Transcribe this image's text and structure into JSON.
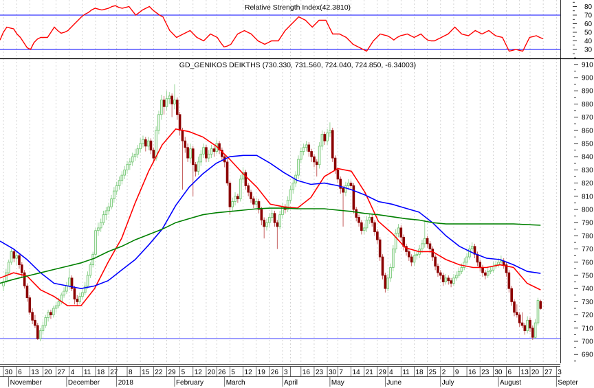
{
  "rsi_panel": {
    "title": "Relative Strength Index(42.3810)",
    "y_ticks": [
      80,
      70,
      60,
      50,
      40,
      30
    ],
    "ylim": [
      22,
      88
    ],
    "overbought": 70,
    "oversold": 30,
    "line_color": "#ff0000",
    "level_color": "#0000ff"
  },
  "price_panel": {
    "title": "GD_GENIKOS DEIKTHS (730.330, 731.560, 724.040, 724.850, -6.34003)",
    "y_ticks": [
      910,
      900,
      890,
      880,
      870,
      860,
      850,
      840,
      830,
      820,
      810,
      800,
      790,
      780,
      770,
      760,
      750,
      740,
      730,
      720,
      710,
      700,
      690
    ],
    "support_level": 702,
    "up_color": "#5cb85c",
    "down_color": "#8b0000"
  },
  "x_axis": {
    "day_labels": [
      "30",
      "6",
      "13",
      "20",
      "27",
      "4",
      "11",
      "18",
      "27",
      "",
      "8",
      "15",
      "22",
      "29",
      "5",
      "12",
      "20",
      "26",
      "5",
      "12",
      "19",
      "26",
      "3",
      "",
      "16",
      "23",
      "30",
      "7",
      "14",
      "21",
      "29",
      "4",
      "11",
      "18",
      "25",
      "2",
      "9",
      "16",
      "23",
      "30",
      "6",
      "13",
      "20",
      "27",
      "3"
    ],
    "month_labels": [
      "November",
      "December",
      "2018",
      "February",
      "March",
      "April",
      "May",
      "June",
      "July",
      "August",
      "Septer"
    ]
  },
  "chart_data": {
    "type": "candlestick",
    "title": "GD_GENIKOS DEIKTHS",
    "last_bar": {
      "open": 730.33,
      "high": 731.56,
      "low": 724.04,
      "close": 724.85,
      "change": -6.34003
    },
    "ylim": [
      685,
      915
    ],
    "grid": "vertical dotted",
    "candles_ohlc": [
      [
        742,
        748,
        738,
        745
      ],
      [
        745,
        755,
        744,
        752
      ],
      [
        752,
        762,
        750,
        760
      ],
      [
        760,
        770,
        758,
        768
      ],
      [
        768,
        770,
        760,
        763
      ],
      [
        763,
        768,
        758,
        765
      ],
      [
        765,
        767,
        755,
        758
      ],
      [
        758,
        760,
        748,
        752
      ],
      [
        752,
        754,
        740,
        742
      ],
      [
        742,
        744,
        730,
        733
      ],
      [
        733,
        735,
        720,
        722
      ],
      [
        722,
        725,
        713,
        716
      ],
      [
        716,
        720,
        710,
        712
      ],
      [
        712,
        714,
        701,
        702
      ],
      [
        702,
        710,
        700,
        708
      ],
      [
        708,
        715,
        705,
        712
      ],
      [
        712,
        720,
        710,
        718
      ],
      [
        718,
        724,
        715,
        722
      ],
      [
        722,
        724,
        717,
        720
      ],
      [
        720,
        727,
        718,
        725
      ],
      [
        725,
        730,
        722,
        727
      ],
      [
        727,
        733,
        725,
        730
      ],
      [
        730,
        737,
        728,
        735
      ],
      [
        735,
        741,
        733,
        738
      ],
      [
        738,
        745,
        736,
        742
      ],
      [
        742,
        755,
        740,
        748
      ],
      [
        748,
        750,
        738,
        740
      ],
      [
        740,
        742,
        728,
        732
      ],
      [
        732,
        735,
        727,
        730
      ],
      [
        730,
        737,
        728,
        734
      ],
      [
        734,
        740,
        732,
        737
      ],
      [
        737,
        745,
        735,
        742
      ],
      [
        742,
        753,
        740,
        750
      ],
      [
        750,
        760,
        748,
        758
      ],
      [
        758,
        768,
        756,
        766
      ],
      [
        766,
        786,
        764,
        784
      ],
      [
        784,
        790,
        780,
        786
      ],
      [
        786,
        793,
        783,
        790
      ],
      [
        790,
        799,
        788,
        796
      ],
      [
        796,
        802,
        792,
        799
      ],
      [
        799,
        805,
        796,
        802
      ],
      [
        802,
        811,
        800,
        808
      ],
      [
        808,
        817,
        805,
        814
      ],
      [
        814,
        821,
        811,
        818
      ],
      [
        818,
        825,
        815,
        822
      ],
      [
        822,
        829,
        819,
        826
      ],
      [
        826,
        833,
        823,
        830
      ],
      [
        830,
        837,
        827,
        834
      ],
      [
        834,
        839,
        830,
        836
      ],
      [
        836,
        843,
        833,
        840
      ],
      [
        840,
        846,
        837,
        842
      ],
      [
        842,
        849,
        839,
        846
      ],
      [
        846,
        854,
        843,
        850
      ],
      [
        850,
        856,
        847,
        853
      ],
      [
        853,
        855,
        844,
        848
      ],
      [
        848,
        855,
        845,
        852
      ],
      [
        852,
        854,
        842,
        845
      ],
      [
        845,
        847,
        835,
        839
      ],
      [
        839,
        863,
        837,
        860
      ],
      [
        860,
        875,
        857,
        872
      ],
      [
        872,
        887,
        868,
        883
      ],
      [
        883,
        886,
        872,
        878
      ],
      [
        878,
        890,
        875,
        884
      ],
      [
        884,
        889,
        880,
        886
      ],
      [
        886,
        888,
        870,
        880
      ],
      [
        880,
        895,
        876,
        883
      ],
      [
        883,
        885,
        868,
        872
      ],
      [
        872,
        874,
        856,
        860
      ],
      [
        860,
        862,
        815,
        852
      ],
      [
        852,
        855,
        843,
        847
      ],
      [
        847,
        850,
        836,
        839
      ],
      [
        839,
        850,
        835,
        846
      ],
      [
        846,
        848,
        810,
        834
      ],
      [
        834,
        836,
        825,
        829
      ],
      [
        829,
        840,
        826,
        836
      ],
      [
        836,
        845,
        833,
        842
      ],
      [
        842,
        850,
        839,
        847
      ],
      [
        847,
        849,
        836,
        839
      ],
      [
        839,
        845,
        836,
        842
      ],
      [
        842,
        849,
        839,
        846
      ],
      [
        846,
        848,
        840,
        844
      ],
      [
        844,
        853,
        842,
        850
      ],
      [
        850,
        852,
        842,
        845
      ],
      [
        845,
        847,
        837,
        840
      ],
      [
        840,
        842,
        832,
        836
      ],
      [
        836,
        838,
        818,
        820
      ],
      [
        820,
        822,
        796,
        802
      ],
      [
        802,
        809,
        799,
        806
      ],
      [
        806,
        813,
        803,
        810
      ],
      [
        810,
        812,
        805,
        808
      ],
      [
        808,
        826,
        806,
        823
      ],
      [
        823,
        832,
        820,
        828
      ],
      [
        828,
        830,
        815,
        818
      ],
      [
        818,
        820,
        810,
        813
      ],
      [
        813,
        815,
        805,
        808
      ],
      [
        808,
        810,
        801,
        804
      ],
      [
        804,
        809,
        801,
        806
      ],
      [
        806,
        808,
        797,
        800
      ],
      [
        800,
        802,
        788,
        792
      ],
      [
        792,
        794,
        778,
        787
      ],
      [
        787,
        793,
        784,
        790
      ],
      [
        790,
        797,
        787,
        794
      ],
      [
        794,
        800,
        791,
        797
      ],
      [
        797,
        799,
        787,
        790
      ],
      [
        790,
        792,
        770,
        787
      ],
      [
        787,
        799,
        785,
        796
      ],
      [
        796,
        805,
        793,
        802
      ],
      [
        802,
        804,
        797,
        800
      ],
      [
        800,
        810,
        798,
        807
      ],
      [
        807,
        818,
        805,
        815
      ],
      [
        815,
        823,
        812,
        820
      ],
      [
        820,
        829,
        817,
        826
      ],
      [
        826,
        841,
        823,
        838
      ],
      [
        838,
        847,
        835,
        844
      ],
      [
        844,
        850,
        841,
        847
      ],
      [
        847,
        852,
        844,
        849
      ],
      [
        849,
        851,
        840,
        844
      ],
      [
        844,
        846,
        836,
        840
      ],
      [
        840,
        842,
        832,
        836
      ],
      [
        836,
        838,
        825,
        834
      ],
      [
        834,
        851,
        831,
        848
      ],
      [
        848,
        860,
        845,
        857
      ],
      [
        857,
        859,
        849,
        852
      ],
      [
        852,
        861,
        849,
        858
      ],
      [
        858,
        866,
        855,
        860
      ],
      [
        860,
        862,
        836,
        839
      ],
      [
        839,
        841,
        827,
        830
      ],
      [
        830,
        832,
        820,
        823
      ],
      [
        823,
        825,
        812,
        816
      ],
      [
        816,
        818,
        787,
        813
      ],
      [
        813,
        821,
        810,
        818
      ],
      [
        818,
        823,
        815,
        820
      ],
      [
        820,
        822,
        815,
        818
      ],
      [
        818,
        820,
        797,
        800
      ],
      [
        800,
        802,
        791,
        794
      ],
      [
        794,
        796,
        787,
        790
      ],
      [
        790,
        792,
        781,
        784
      ],
      [
        784,
        789,
        781,
        786
      ],
      [
        786,
        795,
        783,
        792
      ],
      [
        792,
        797,
        789,
        794
      ],
      [
        794,
        796,
        787,
        790
      ],
      [
        790,
        792,
        780,
        783
      ],
      [
        783,
        785,
        774,
        777
      ],
      [
        777,
        779,
        761,
        764
      ],
      [
        764,
        766,
        747,
        750
      ],
      [
        750,
        752,
        737,
        740
      ],
      [
        740,
        751,
        738,
        748
      ],
      [
        748,
        759,
        745,
        756
      ],
      [
        756,
        773,
        753,
        770
      ],
      [
        770,
        785,
        767,
        782
      ],
      [
        782,
        789,
        779,
        786
      ],
      [
        786,
        788,
        776,
        779
      ],
      [
        779,
        781,
        769,
        772
      ],
      [
        772,
        774,
        765,
        768
      ],
      [
        768,
        770,
        761,
        764
      ],
      [
        764,
        766,
        757,
        760
      ],
      [
        760,
        768,
        757,
        765
      ],
      [
        765,
        769,
        762,
        766
      ],
      [
        766,
        773,
        763,
        770
      ],
      [
        770,
        777,
        767,
        774
      ],
      [
        774,
        792,
        771,
        778
      ],
      [
        778,
        780,
        771,
        774
      ],
      [
        774,
        776,
        767,
        770
      ],
      [
        770,
        772,
        761,
        764
      ],
      [
        764,
        766,
        754,
        757
      ],
      [
        757,
        759,
        749,
        752
      ],
      [
        752,
        754,
        747,
        750
      ],
      [
        750,
        752,
        742,
        745
      ],
      [
        745,
        751,
        743,
        748
      ],
      [
        748,
        750,
        743,
        746
      ],
      [
        746,
        748,
        741,
        744
      ],
      [
        744,
        751,
        742,
        748
      ],
      [
        748,
        753,
        746,
        750
      ],
      [
        750,
        756,
        748,
        753
      ],
      [
        753,
        759,
        751,
        756
      ],
      [
        756,
        763,
        754,
        760
      ],
      [
        760,
        767,
        758,
        764
      ],
      [
        764,
        773,
        762,
        770
      ],
      [
        770,
        775,
        768,
        772
      ],
      [
        772,
        774,
        763,
        766
      ],
      [
        766,
        768,
        757,
        760
      ],
      [
        760,
        762,
        753,
        756
      ],
      [
        756,
        758,
        749,
        752
      ],
      [
        752,
        754,
        747,
        750
      ],
      [
        750,
        756,
        748,
        753
      ],
      [
        753,
        757,
        751,
        754
      ],
      [
        754,
        760,
        752,
        757
      ],
      [
        757,
        761,
        755,
        758
      ],
      [
        758,
        763,
        756,
        760
      ],
      [
        760,
        765,
        758,
        761
      ],
      [
        761,
        763,
        755,
        758
      ],
      [
        758,
        760,
        749,
        752
      ],
      [
        752,
        754,
        737,
        740
      ],
      [
        740,
        742,
        727,
        730
      ],
      [
        730,
        732,
        719,
        722
      ],
      [
        722,
        728,
        718,
        720
      ],
      [
        720,
        722,
        711,
        714
      ],
      [
        714,
        722,
        710,
        712
      ],
      [
        712,
        714,
        705,
        708
      ],
      [
        708,
        719,
        706,
        716
      ],
      [
        716,
        718,
        707,
        710
      ],
      [
        710,
        712,
        701,
        703
      ],
      [
        703,
        717,
        702,
        714
      ],
      [
        714,
        733,
        712,
        731
      ],
      [
        730.33,
        731.56,
        724.04,
        724.85
      ]
    ],
    "moving_averages": [
      {
        "color": "#ff0000",
        "values": [
          748,
          752,
          749.5,
          739,
          734,
          727,
          727,
          740,
          760,
          778,
          805,
          829,
          849,
          861,
          859,
          855,
          848,
          838,
          827,
          817,
          804,
          802,
          801,
          809,
          825,
          831,
          829,
          813,
          791,
          782,
          771,
          768,
          768,
          762,
          758,
          756,
          756,
          758,
          756,
          744,
          739
        ]
      },
      {
        "color": "#0000ff",
        "values": [
          776,
          770,
          762,
          752,
          744,
          742,
          740,
          742,
          746,
          754,
          762,
          773,
          785,
          803,
          817,
          827,
          835,
          840,
          841,
          841,
          835,
          828,
          822,
          819,
          820,
          818,
          815,
          811,
          806,
          804,
          801,
          798,
          790,
          780,
          772,
          767,
          763,
          762,
          758,
          753,
          751.5
        ]
      },
      {
        "color": "#008000",
        "values": [
          744,
          747,
          749.5,
          752,
          754.5,
          757,
          759.5,
          763,
          768,
          772,
          777,
          781,
          785,
          790,
          793,
          796,
          797.5,
          798.5,
          799.5,
          800.5,
          801,
          801,
          800.5,
          800.5,
          800.5,
          799.5,
          798.5,
          797,
          796,
          794.5,
          793,
          792,
          790,
          789,
          789,
          789,
          789,
          789,
          789,
          788.5,
          788
        ]
      }
    ],
    "rsi_values": [
      41,
      50,
      56,
      55,
      54,
      48,
      44,
      38,
      32,
      30,
      38,
      42,
      44,
      44,
      44,
      50,
      56,
      52,
      49,
      50,
      52,
      56,
      60,
      64,
      68,
      71,
      73,
      76,
      78,
      77,
      76,
      77,
      78,
      80,
      81,
      79,
      78,
      79,
      80,
      75,
      70,
      73,
      76,
      78,
      80,
      76,
      73,
      70,
      68,
      60,
      52,
      48,
      44,
      46,
      48,
      50,
      52,
      48,
      44,
      42,
      40,
      44,
      48,
      46,
      44,
      38,
      33,
      34,
      36,
      42,
      48,
      50,
      52,
      50,
      48,
      44,
      40,
      38,
      36,
      38,
      40,
      40,
      40,
      46,
      52,
      56,
      60,
      64,
      68,
      66,
      64,
      60,
      56,
      60,
      64,
      64,
      64,
      56,
      48,
      48,
      48,
      46,
      44,
      40,
      36,
      34,
      32,
      30,
      28,
      34,
      40,
      44,
      48,
      47,
      46,
      44,
      41,
      44,
      46,
      47,
      48,
      46,
      44,
      46,
      48,
      44,
      41,
      40,
      40,
      42,
      44,
      46,
      48,
      52,
      56,
      52,
      48,
      47,
      46,
      49,
      52,
      50,
      48,
      50,
      52,
      49,
      46,
      45,
      44,
      36,
      28,
      29,
      30,
      29,
      28,
      36,
      44,
      45,
      46,
      44,
      42.38
    ]
  }
}
